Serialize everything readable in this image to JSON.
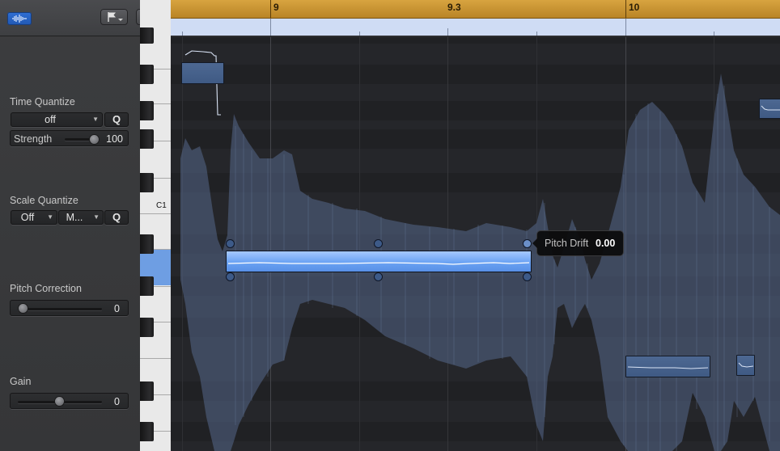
{
  "toolbar": {
    "waveform_icon": "waveform-icon",
    "flag_icon": "flag-icon",
    "menu_icon": "chevron-down-icon"
  },
  "time_quantize": {
    "title": "Time Quantize",
    "value": "off",
    "q_label": "Q",
    "strength_label": "Strength",
    "strength_value": "100",
    "strength_level": 1.0
  },
  "scale_quantize": {
    "title": "Scale Quantize",
    "key_value": "Off",
    "scale_value": "M...",
    "q_label": "Q"
  },
  "pitch_correction": {
    "title": "Pitch Correction",
    "value": "0",
    "level": 0.0
  },
  "gain": {
    "title": "Gain",
    "value": "0",
    "level": 0.5
  },
  "keyboard": {
    "c_label": "C1"
  },
  "ruler": {
    "labels": [
      "9",
      "9.3",
      "10"
    ]
  },
  "tooltip": {
    "label": "Pitch Drift",
    "value": "0.00"
  },
  "colors": {
    "ruler_top": "#c99434",
    "ruler_bottom": "#cfdcf4",
    "selected_note": "#6aa2f3",
    "note": "#45608a",
    "waveform": "#5d6f8c",
    "accent": "#2f6fd4"
  }
}
